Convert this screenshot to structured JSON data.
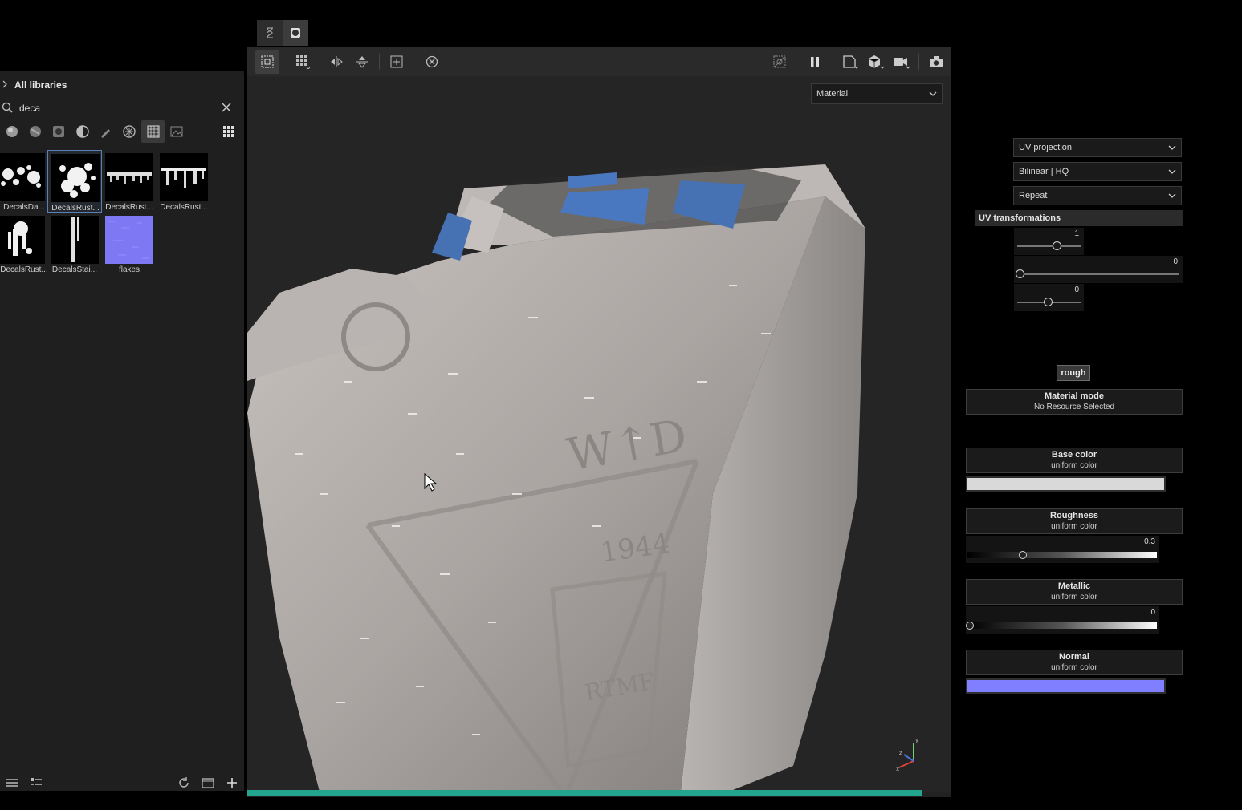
{
  "mini_toolbar": {
    "icons": [
      "hourglass-icon",
      "material-ball-icon"
    ]
  },
  "library": {
    "header": "All libraries",
    "search": {
      "value": "deca"
    },
    "filters": [
      "material-filter-icon",
      "smart-material-filter-icon",
      "mask-filter-icon",
      "generator-filter-icon",
      "brush-filter-icon",
      "particles-filter-icon",
      "texture-filter-icon",
      "environment-filter-icon"
    ],
    "items": [
      {
        "label": "DecalsDa..."
      },
      {
        "label": "DecalsRust...",
        "selected": true
      },
      {
        "label": "DecalsRust..."
      },
      {
        "label": "DecalsRust..."
      },
      {
        "label": "DecalsRust..."
      },
      {
        "label": "DecalsStai..."
      },
      {
        "label": "flakes"
      }
    ]
  },
  "viewport": {
    "mode": "Material",
    "progress": 0.958,
    "embossed_text": [
      "W↑D",
      "1944",
      "RTMF"
    ],
    "axis_labels": [
      "y",
      "z",
      "x"
    ]
  },
  "properties": {
    "uv_projection": "UV projection",
    "filtering": "Bilinear | HQ",
    "tiling": "Repeat",
    "uv_transformations_title": "UV transformations",
    "uv_scale": "1",
    "uv_rotation": "0",
    "uv_offset": "0",
    "resource_tag": "rough",
    "material_mode": {
      "title": "Material mode",
      "value": "No Resource Selected"
    },
    "base_color": {
      "title": "Base color",
      "value": "uniform color",
      "swatch": "#d9d9d9"
    },
    "roughness": {
      "title": "Roughness",
      "value": "uniform color",
      "amount": "0.3"
    },
    "metallic": {
      "title": "Metallic",
      "value": "uniform color",
      "amount": "0"
    },
    "normal": {
      "title": "Normal",
      "value": "uniform color",
      "swatch": "#7f7fff"
    }
  },
  "colors": {
    "accent_progress": "#23a58d",
    "selection": "#5b7fb8"
  }
}
